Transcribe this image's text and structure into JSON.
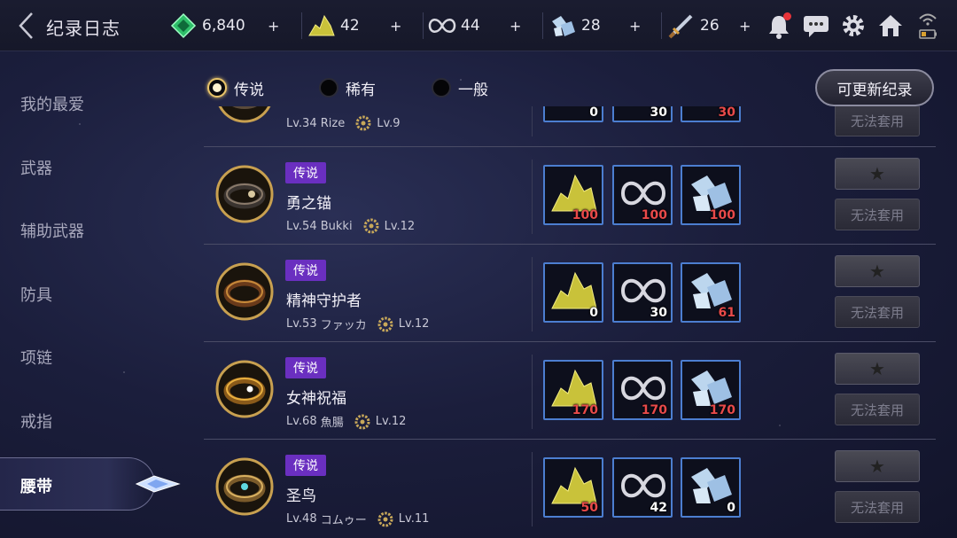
{
  "header": {
    "title": "纪录日志",
    "resources": [
      {
        "icon": "green-gem-icon",
        "value": "6,840"
      },
      {
        "icon": "gold-ore-icon",
        "value": "42"
      },
      {
        "icon": "infinity-chain-icon",
        "value": "44"
      },
      {
        "icon": "ice-crystal-icon",
        "value": "28"
      },
      {
        "icon": "dagger-icon",
        "value": "26"
      }
    ]
  },
  "sidebar": {
    "items": [
      {
        "label": "我的最爱"
      },
      {
        "label": "武器"
      },
      {
        "label": "辅助武器"
      },
      {
        "label": "防具"
      },
      {
        "label": "项链"
      },
      {
        "label": "戒指"
      },
      {
        "label": "腰带",
        "active": true
      }
    ]
  },
  "filters": {
    "options": [
      {
        "label": "传说",
        "selected": true
      },
      {
        "label": "稀有",
        "selected": false
      },
      {
        "label": "一般",
        "selected": false
      }
    ],
    "update_button": "可更新纪录"
  },
  "items": [
    {
      "grade": "",
      "name": "",
      "level": "Lv.34",
      "owner": "Rize",
      "sub_level": "Lv.9",
      "materials": [
        "0",
        "30",
        "30"
      ],
      "materials_red": [
        false,
        false,
        true
      ],
      "apply_label": "无法套用"
    },
    {
      "grade": "传说",
      "name": "勇之锚",
      "level": "Lv.54",
      "owner": "Bukki",
      "sub_level": "Lv.12",
      "materials": [
        "100",
        "100",
        "100"
      ],
      "materials_red": [
        true,
        true,
        true
      ],
      "apply_label": "无法套用"
    },
    {
      "grade": "传说",
      "name": "精神守护者",
      "level": "Lv.53",
      "owner": "ファッカ",
      "sub_level": "Lv.12",
      "materials": [
        "0",
        "30",
        "61"
      ],
      "materials_red": [
        false,
        false,
        true
      ],
      "apply_label": "无法套用"
    },
    {
      "grade": "传说",
      "name": "女神祝福",
      "level": "Lv.68",
      "owner": "魚腸",
      "sub_level": "Lv.12",
      "materials": [
        "170",
        "170",
        "170"
      ],
      "materials_red": [
        true,
        true,
        true
      ],
      "apply_label": "无法套用"
    },
    {
      "grade": "传说",
      "name": "圣鸟",
      "level": "Lv.48",
      "owner": "コムゥー",
      "sub_level": "Lv.11",
      "materials": [
        "50",
        "42",
        "0"
      ],
      "materials_red": [
        true,
        false,
        false
      ],
      "apply_label": "无法套用"
    }
  ],
  "colors": {
    "legend_badge": "#6a2fc0",
    "material_border": "#4c7ed0",
    "shortage_red": "#e84a4a"
  }
}
